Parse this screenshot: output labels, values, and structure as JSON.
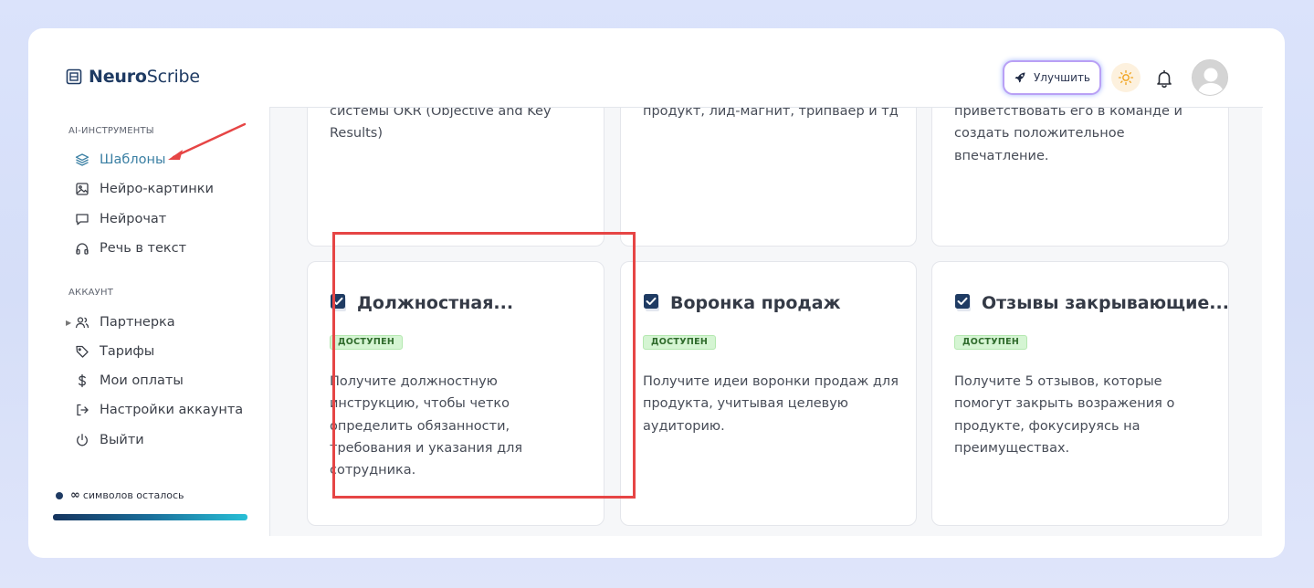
{
  "app": {
    "logo_bold": "Neuro",
    "logo_light": "Scribe"
  },
  "header": {
    "upgrade_label": "Улучшить",
    "icons": [
      "rocket-icon",
      "sun-icon",
      "bell-icon",
      "avatar"
    ]
  },
  "sidebar": {
    "section_tools": "AI-ИНСТРУМЕНТЫ",
    "tools": [
      {
        "label": "Шаблоны",
        "icon": "layers-icon",
        "active": true
      },
      {
        "label": "Нейро-картинки",
        "icon": "image-icon"
      },
      {
        "label": "Нейрочат",
        "icon": "chat-icon"
      },
      {
        "label": "Речь в текст",
        "icon": "headphones-icon"
      }
    ],
    "section_account": "АККАУНТ",
    "account": [
      {
        "label": "Партнерка",
        "icon": "users-icon"
      },
      {
        "label": "Тарифы",
        "icon": "tag-icon"
      },
      {
        "label": "Мои оплаты",
        "icon": "dollar-icon"
      },
      {
        "label": "Настройки аккаунта",
        "icon": "logout-icon"
      },
      {
        "label": "Выйти",
        "icon": "power-icon"
      }
    ],
    "usage": {
      "symbol": "∞",
      "label": "символов осталось"
    }
  },
  "top_cards": [
    {
      "desc": "системы OKR (Objective and Key Results)"
    },
    {
      "desc": "продукт, лид-магнит, трипваер и тд"
    },
    {
      "desc": "приветствовать его в команде и создать положительное впечатление."
    }
  ],
  "cards": [
    {
      "title": "Должностная...",
      "badge": "ДОСТУПЕН",
      "desc": "Получите должностную инструкцию, чтобы четко определить обязанности, требования и указания для сотрудника.",
      "highlighted": true
    },
    {
      "title": "Воронка продаж",
      "badge": "ДОСТУПЕН",
      "desc": "Получите идеи воронки продаж для продукта, учитывая целевую аудиторию."
    },
    {
      "title": "Отзывы закрывающие...",
      "badge": "ДОСТУПЕН",
      "desc": "Получите 5 отзывов, которые помогут закрыть возражения о продукте, фокусируясь на преимуществах."
    }
  ],
  "colors": {
    "accent": "#3a7fa3",
    "brand": "#1f3b63",
    "badge_bg": "#d5f5d3",
    "highlight": "#e64545",
    "arrow": "#e64545"
  }
}
